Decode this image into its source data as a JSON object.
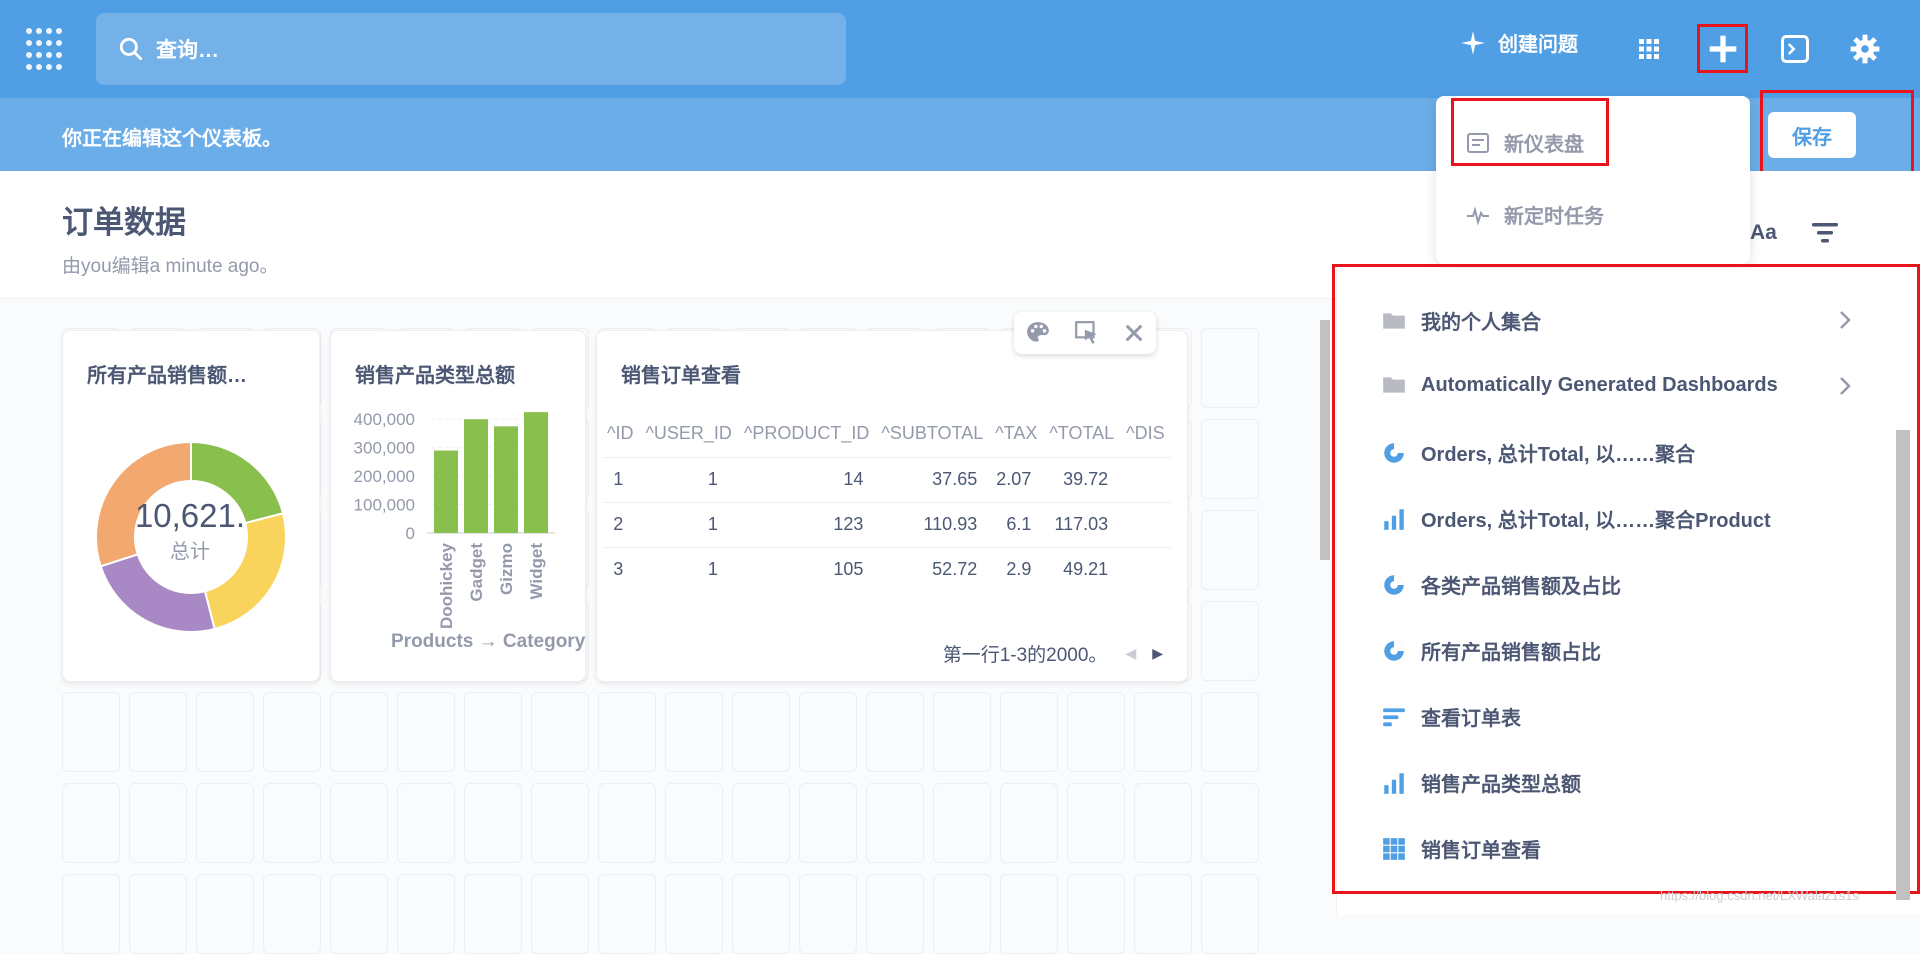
{
  "nav": {
    "search_placeholder": "查询…",
    "new_question": "创建问题"
  },
  "edit_bar": {
    "message": "你正在编辑这个仪表板。",
    "save": "保存"
  },
  "new_menu": {
    "items": [
      "新仪表盘",
      "新定时任务"
    ]
  },
  "dashboard": {
    "title": "订单数据",
    "subtitle": "由you编辑a minute ago。",
    "text_tool": "Aa"
  },
  "cards": {
    "donut": {
      "title": "所有产品销售额…",
      "center_value": "10,621.",
      "center_label": "总计"
    },
    "bar": {
      "title": "销售产品类型总额",
      "x_title": "Products → Category"
    },
    "table": {
      "title": "销售订单查看",
      "columns": [
        "ID",
        "USER_ID",
        "PRODUCT_ID",
        "SUBTOTAL",
        "TAX",
        "TOTAL",
        "DIS"
      ],
      "rows": [
        [
          "1",
          "1",
          "14",
          "37.65",
          "2.07",
          "39.72"
        ],
        [
          "2",
          "1",
          "123",
          "110.93",
          "6.1",
          "117.03"
        ],
        [
          "3",
          "1",
          "105",
          "52.72",
          "2.9",
          "49.21"
        ]
      ],
      "pager": "第一行1-3的2000。"
    }
  },
  "chart_data": [
    {
      "type": "pie",
      "categories": [
        "Doohickey",
        "Gadget",
        "Gizmo",
        "Widget"
      ],
      "values": [
        21,
        25,
        24,
        30
      ],
      "colors": [
        "#88bf4d",
        "#f9d45c",
        "#a989c5",
        "#f2a86f"
      ]
    },
    {
      "type": "bar",
      "categories": [
        "Doohickey",
        "Gadget",
        "Gizmo",
        "Widget"
      ],
      "values": [
        290000,
        400000,
        375000,
        425000
      ],
      "ylim": [
        0,
        450000
      ],
      "yticks": [
        "400,000",
        "300,000",
        "200,000",
        "100,000",
        "0"
      ],
      "xlabel": "Products → Category",
      "color": "#88bf4d"
    }
  ],
  "side_panel": {
    "items": [
      {
        "label": "我的个人集合",
        "icon": "folder-icon",
        "chevron": true
      },
      {
        "label": "Automatically Generated Dashboards",
        "icon": "folder-icon",
        "chevron": true
      },
      {
        "label": "Orders, 总计Total, 以……聚合",
        "icon": "pie-chart-icon",
        "chevron": false
      },
      {
        "label": "Orders, 总计Total, 以……聚合Product",
        "icon": "bar-chart-icon",
        "chevron": false
      },
      {
        "label": "各类产品销售额及占比",
        "icon": "pie-chart-icon",
        "chevron": false
      },
      {
        "label": "所有产品销售额占比",
        "icon": "pie-chart-icon",
        "chevron": false
      },
      {
        "label": "查看订单表",
        "icon": "list-icon",
        "chevron": false
      },
      {
        "label": "销售产品类型总额",
        "icon": "bar-chart-icon",
        "chevron": false
      },
      {
        "label": "销售订单查看",
        "icon": "table-icon",
        "chevron": false
      }
    ]
  },
  "watermark": "https://blog.csdn.net/LXWalaz1s1s"
}
